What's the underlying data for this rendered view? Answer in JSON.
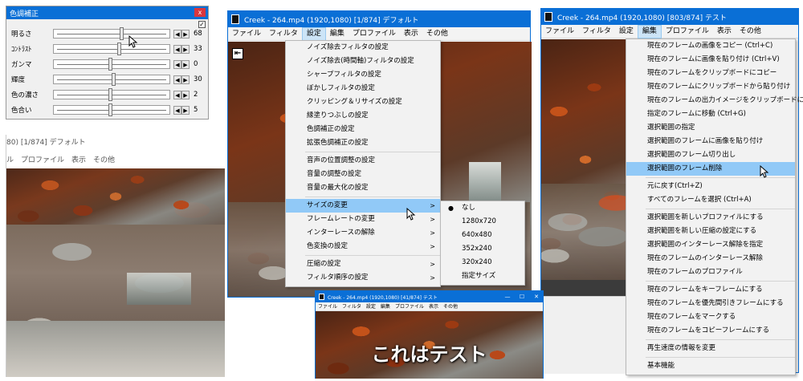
{
  "color_panel": {
    "title": "色調補正",
    "close": "x",
    "check": "✓",
    "rows": [
      {
        "label": "明るさ",
        "value": "68",
        "level": 0.6
      },
      {
        "label": "ｺﾝﾄﾗｽﾄ",
        "value": "33",
        "level": 0.58
      },
      {
        "label": "ガンマ",
        "value": "0",
        "level": 0.5
      },
      {
        "label": "輝度",
        "value": "30",
        "level": 0.53
      },
      {
        "label": "色の濃さ",
        "value": "2",
        "level": 0.5
      },
      {
        "label": "色合い",
        "value": "5",
        "level": 0.5
      }
    ],
    "arrow_left": "◀",
    "arrow_right": "▶"
  },
  "bg_left": {
    "title": "80) [1/874] デフォルト",
    "menu": [
      "ル",
      "プロファイル",
      "表示",
      "その他"
    ]
  },
  "win_mid": {
    "title": "Creek - 264.mp4 (1920,1080)  [1/874]  デフォルト",
    "menu": [
      "ファイル",
      "フィルタ",
      "設定",
      "編集",
      "プロファイル",
      "表示",
      "その他"
    ],
    "active_menu_index": 2,
    "back_button": "⇤"
  },
  "settings_menu": {
    "group1": [
      "ノイズ除去フィルタの設定",
      "ノイズ除去(時間軸)フィルタの設定",
      "シャープフィルタの設定",
      "ぼかしフィルタの設定",
      "クリッピング＆リサイズの設定",
      "縁塗りつぶしの設定",
      "色調補正の設定",
      "拡張色調補正の設定"
    ],
    "group2": [
      "音声の位置調整の設定",
      "音量の調整の設定",
      "音量の最大化の設定"
    ],
    "group3": [
      {
        "label": "サイズの変更",
        "arrow": ">",
        "highlighted": true
      },
      {
        "label": "フレームレートの変更",
        "arrow": ">"
      },
      {
        "label": "インターレースの解除",
        "arrow": ">"
      },
      {
        "label": "色変換の設定",
        "arrow": ">"
      }
    ],
    "group4": [
      {
        "label": "圧縮の設定",
        "arrow": ">"
      },
      {
        "label": "フィルタ順序の設定",
        "arrow": ">"
      }
    ]
  },
  "size_submenu": {
    "bullet": "●",
    "items": [
      "なし",
      "1280x720",
      "640x480",
      "352x240",
      "320x240",
      "指定サイズ"
    ]
  },
  "win_right": {
    "title": "Creek - 264.mp4 (1920,1080)  [803/874]  テスト",
    "menu": [
      "ファイル",
      "フィルタ",
      "設定",
      "編集",
      "プロファイル",
      "表示",
      "その他"
    ],
    "active_menu_index": 3
  },
  "edit_menu": {
    "group1": [
      "現在のフレームの画像をコピー (Ctrl+C)",
      "現在のフレームに画像を貼り付け (Ctrl+V)",
      "現在のフレームをクリップボードにコピー",
      "現在のフレームにクリップボードから貼り付け",
      "現在のフレームの出力イメージをクリップボードにコピー",
      "指定のフレームに移動 (Ctrl+G)",
      "選択範囲の指定",
      "選択範囲のフレームに画像を貼り付け",
      "選択範囲のフレーム切り出し",
      "選択範囲のフレーム削除"
    ],
    "highlighted": "選択範囲のフレーム削除",
    "group2": [
      "元に戻す(Ctrl+Z)",
      "すべてのフレームを選択 (Ctrl+A)"
    ],
    "group3": [
      "選択範囲を新しいプロファイルにする",
      "選択範囲を新しい圧縮の設定にする",
      "選択範囲のインターレース解除を指定",
      "現在のフレームのインターレース解除",
      "現在のフレームのプロファイル"
    ],
    "group4": [
      "現在のフレームをキーフレームにする",
      "現在のフレームを優先間引きフレームにする",
      "現在のフレームをマークする",
      "現在のフレームをコピーフレームにする"
    ],
    "group5": [
      "再生速度の情報を変更"
    ],
    "group6": [
      "基本機能"
    ]
  },
  "win_small": {
    "title": "Creek - 264.mp4 (1920,1080) [41/874] テスト",
    "menu": [
      "ファイル",
      "フィルタ",
      "設定",
      "編集",
      "プロファイル",
      "表示",
      "その他"
    ],
    "caption": "これはテスト",
    "controls": [
      "—",
      "☐",
      "✕"
    ]
  }
}
